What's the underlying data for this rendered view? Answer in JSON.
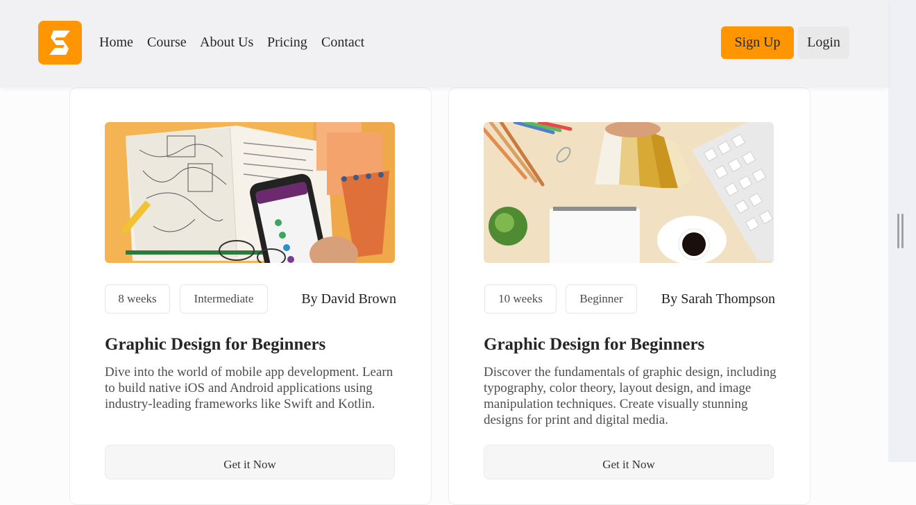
{
  "header": {
    "nav": [
      "Home",
      "Course",
      "About Us",
      "Pricing",
      "Contact"
    ],
    "signup_label": "Sign Up",
    "login_label": "Login",
    "brand_color": "#ff9500"
  },
  "courses": [
    {
      "duration": "8 weeks",
      "level": "Intermediate",
      "author": "By David Brown",
      "title": "Graphic Design for Beginners",
      "description": "Dive into the world of mobile app development. Learn to build native iOS and Android applications using industry-leading frameworks like Swift and Kotlin.",
      "cta": "Get it Now"
    },
    {
      "duration": "10 weeks",
      "level": "Beginner",
      "author": "By Sarah Thompson",
      "title": "Graphic Design for Beginners",
      "description": "Discover the fundamentals of graphic design, including typography, color theory, layout design, and image manipulation techniques. Create visually stunning designs for print and digital media.",
      "cta": "Get it Now"
    }
  ]
}
